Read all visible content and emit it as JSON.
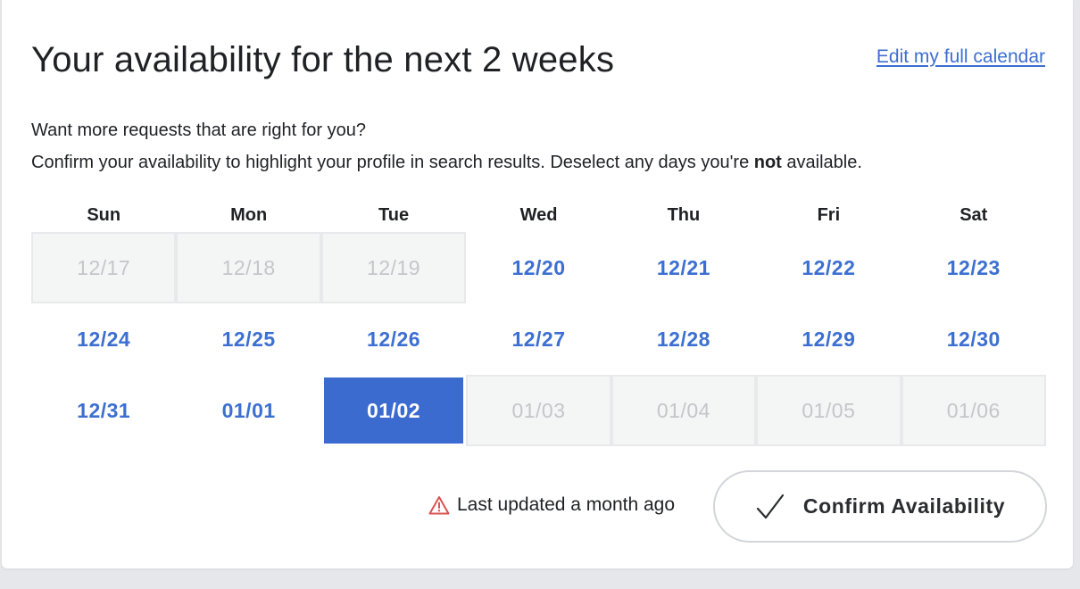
{
  "header": {
    "title": "Your availability for the next 2 weeks",
    "edit_link": "Edit my full calendar"
  },
  "intro": {
    "line1": "Want more requests that are right for you?",
    "line2_before": "Confirm your availability to highlight your profile in search results. Deselect any days you're ",
    "line2_bold": "not",
    "line2_after": " available."
  },
  "calendar": {
    "weekdays": [
      "Sun",
      "Mon",
      "Tue",
      "Wed",
      "Thu",
      "Fri",
      "Sat"
    ],
    "weeks": [
      [
        {
          "label": "12/17",
          "state": "disabled"
        },
        {
          "label": "12/18",
          "state": "disabled"
        },
        {
          "label": "12/19",
          "state": "disabled"
        },
        {
          "label": "12/20",
          "state": "available"
        },
        {
          "label": "12/21",
          "state": "available"
        },
        {
          "label": "12/22",
          "state": "available"
        },
        {
          "label": "12/23",
          "state": "available"
        }
      ],
      [
        {
          "label": "12/24",
          "state": "available"
        },
        {
          "label": "12/25",
          "state": "available"
        },
        {
          "label": "12/26",
          "state": "available"
        },
        {
          "label": "12/27",
          "state": "available"
        },
        {
          "label": "12/28",
          "state": "available"
        },
        {
          "label": "12/29",
          "state": "available"
        },
        {
          "label": "12/30",
          "state": "available"
        }
      ],
      [
        {
          "label": "12/31",
          "state": "available"
        },
        {
          "label": "01/01",
          "state": "available"
        },
        {
          "label": "01/02",
          "state": "selected"
        },
        {
          "label": "01/03",
          "state": "disabled"
        },
        {
          "label": "01/04",
          "state": "disabled"
        },
        {
          "label": "01/05",
          "state": "disabled"
        },
        {
          "label": "01/06",
          "state": "disabled"
        }
      ]
    ]
  },
  "footer": {
    "status_icon": "warning-icon",
    "status_text": "Last updated a month ago",
    "confirm_icon": "checkmark-icon",
    "confirm_label": "Confirm Availability"
  },
  "colors": {
    "accent": "#3c6fd1",
    "selected_bg": "#3c6bd0",
    "disabled_text": "#c4c6c9",
    "disabled_bg": "#f4f5f5",
    "warning": "#d9534f"
  }
}
